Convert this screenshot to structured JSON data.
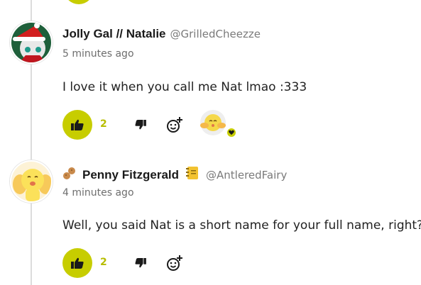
{
  "comments": [
    {
      "display_name": "Jolly Gal // Natalie",
      "handle": "@GrilledCheezze",
      "timestamp": "5 minutes ago",
      "text": "I love it when you call me Nat lmao :333",
      "like_count": "2",
      "avatar_icon": "christmas-panda-avatar",
      "has_reaction": true
    },
    {
      "display_name": "Penny Fitzgerald",
      "handle": "@AntleredFairy",
      "timestamp": "4 minutes ago",
      "text": "Well, you said Nat is a short name for your full name, right?",
      "like_count": "2",
      "avatar_icon": "yellow-cartoon-avatar",
      "badges": [
        "peanut-icon",
        "notebook-icon"
      ]
    }
  ],
  "colors": {
    "accent": "#c7cd00",
    "thread_line": "#dcdcdc",
    "muted_text": "#7a7a7a"
  }
}
